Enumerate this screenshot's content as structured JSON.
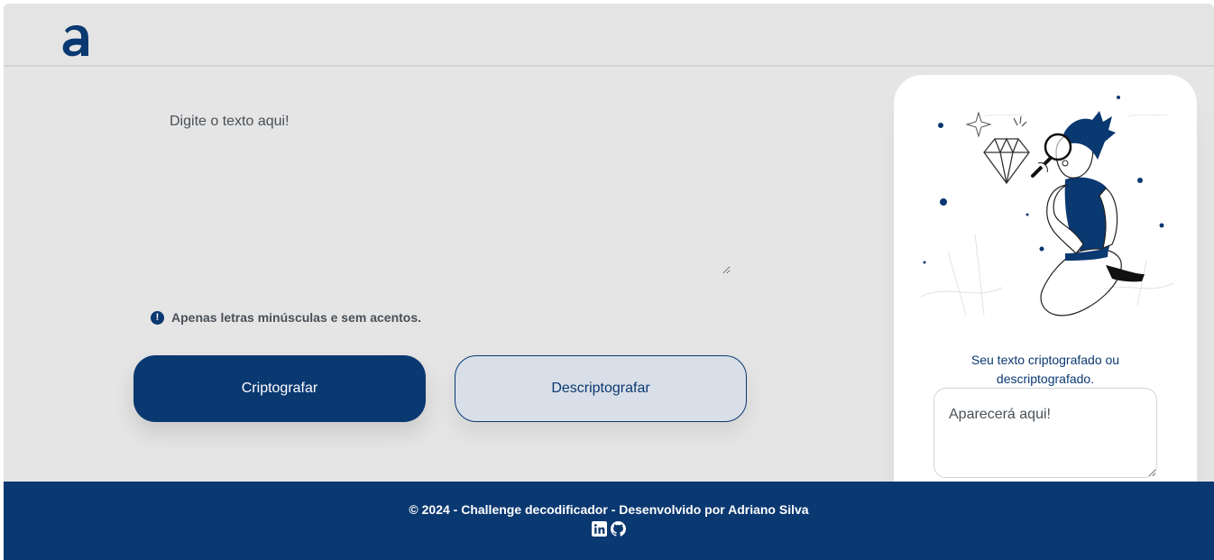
{
  "header": {
    "logo_alt": "Alura logo"
  },
  "input": {
    "placeholder": "Digite o texto aqui!"
  },
  "notice": {
    "icon": "exclamation-circle-icon",
    "text": "Apenas letras minúsculas e sem acentos."
  },
  "buttons": {
    "encrypt_label": "Criptografar",
    "decrypt_label": "Descriptografar"
  },
  "result": {
    "title": "Seu texto criptografado ou descriptografado.",
    "placeholder": "Aparecerá aqui!",
    "illustration": "person-with-magnifying-glass-and-diamond"
  },
  "footer": {
    "text": "© 2024 - Challenge decodificador - Desenvolvido por Adriano Silva",
    "icons": [
      "linkedin-icon",
      "github-icon"
    ]
  },
  "colors": {
    "primary": "#0a3871",
    "background": "#e5e5e5",
    "secondary_button": "#d8dfe8",
    "card": "#ffffff"
  }
}
